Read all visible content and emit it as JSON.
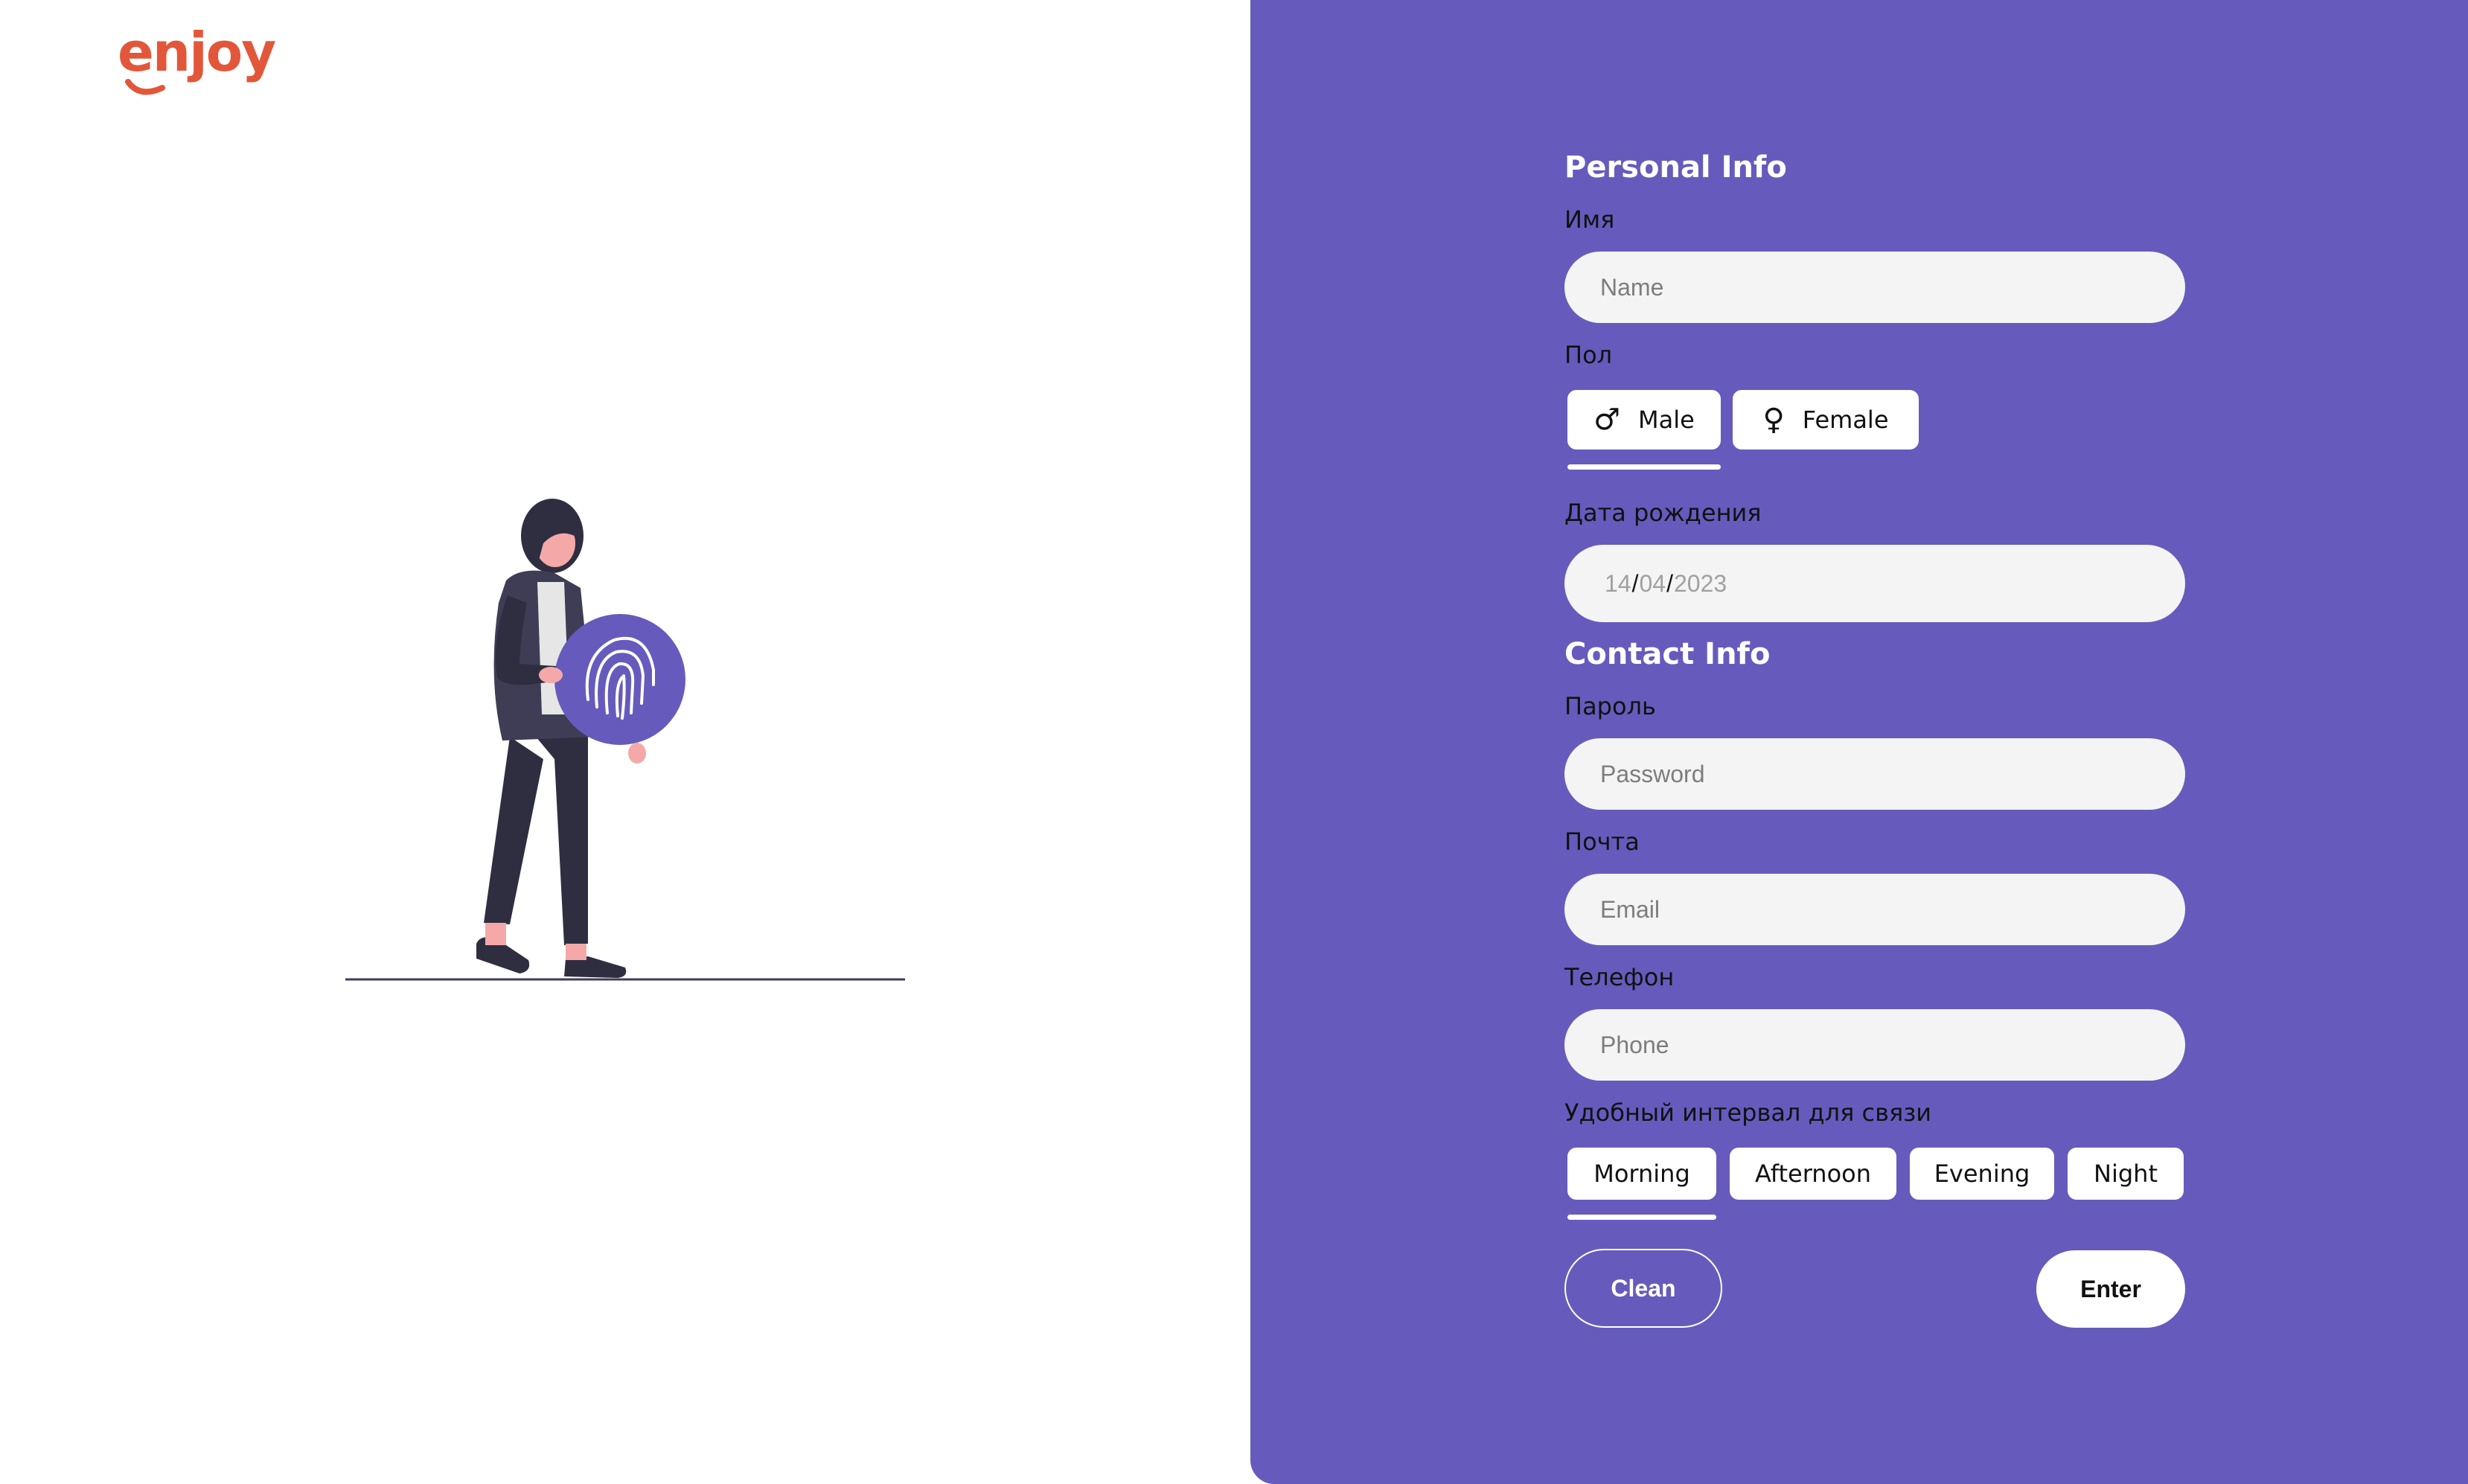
{
  "brand": {
    "logo_text": "enjoy",
    "color": "#e2573a"
  },
  "colors": {
    "panel": "#665bbc",
    "input_bg": "#f4f4f4",
    "text_dark": "#111111",
    "white": "#ffffff"
  },
  "personal": {
    "title": "Personal Info",
    "name_label": "Имя",
    "name_placeholder": "Name",
    "gender_label": "Пол",
    "gender_options": [
      {
        "label": "Male",
        "icon": "male-icon",
        "glyph": "♂",
        "selected": true
      },
      {
        "label": "Female",
        "icon": "female-icon",
        "glyph": "♀",
        "selected": false
      }
    ],
    "dob_label": "Дата рождения",
    "dob": {
      "day": "14",
      "month": "04",
      "year": "2023",
      "separator": "/"
    }
  },
  "contact": {
    "title": "Contact Info",
    "password_label": "Пароль",
    "password_placeholder": "Password",
    "email_label": "Почта",
    "email_placeholder": "Email",
    "phone_label": "Телефон",
    "phone_placeholder": "Phone",
    "interval_label": "Удобный интервал для связи",
    "intervals": [
      {
        "label": "Morning",
        "selected": true
      },
      {
        "label": "Afternoon",
        "selected": false
      },
      {
        "label": "Evening",
        "selected": false
      },
      {
        "label": "Night",
        "selected": false
      }
    ]
  },
  "actions": {
    "clean": "Clean",
    "enter": "Enter"
  }
}
